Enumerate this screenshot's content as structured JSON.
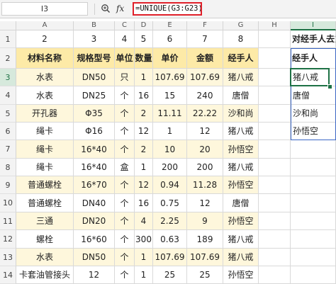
{
  "formula_bar": {
    "name_box": "I3",
    "fx_label": "fx",
    "formula": "=UNIQUE(G3:G23)"
  },
  "columns": [
    "A",
    "B",
    "C",
    "D",
    "E",
    "F",
    "G",
    "H",
    "I"
  ],
  "rows": [
    {
      "num": "1",
      "cells": [
        "2",
        "3",
        "4",
        "5",
        "6",
        "7",
        "8",
        "",
        ""
      ]
    },
    {
      "num": "2",
      "cells": [
        "材料名称",
        "规格型号",
        "单位",
        "数量",
        "单价",
        "金额",
        "经手人",
        "",
        "经手人"
      ]
    },
    {
      "num": "3",
      "cells": [
        "水表",
        "DN50",
        "只",
        "1",
        "107.69",
        "107.69",
        "猪八戒",
        "",
        "猪八戒"
      ]
    },
    {
      "num": "4",
      "cells": [
        "水表",
        "DN25",
        "个",
        "16",
        "15",
        "240",
        "唐僧",
        "",
        "唐僧"
      ]
    },
    {
      "num": "5",
      "cells": [
        "开孔器",
        "Φ35",
        "个",
        "2",
        "11.11",
        "22.22",
        "沙和尚",
        "",
        "沙和尚"
      ]
    },
    {
      "num": "6",
      "cells": [
        "绳卡",
        "Φ16",
        "个",
        "12",
        "1",
        "12",
        "猪八戒",
        "",
        "孙悟空"
      ]
    },
    {
      "num": "7",
      "cells": [
        "绳卡",
        "16*40",
        "个",
        "2",
        "10",
        "20",
        "孙悟空",
        "",
        ""
      ]
    },
    {
      "num": "8",
      "cells": [
        "绳卡",
        "16*40",
        "盒",
        "1",
        "200",
        "200",
        "猪八戒",
        "",
        ""
      ]
    },
    {
      "num": "9",
      "cells": [
        "普通螺栓",
        "16*70",
        "个",
        "12",
        "0.94",
        "11.28",
        "孙悟空",
        "",
        ""
      ]
    },
    {
      "num": "10",
      "cells": [
        "普通螺栓",
        "DN40",
        "个",
        "16",
        "0.75",
        "12",
        "唐僧",
        "",
        ""
      ]
    },
    {
      "num": "11",
      "cells": [
        "三通",
        "DN20",
        "个",
        "4",
        "2.25",
        "9",
        "孙悟空",
        "",
        ""
      ]
    },
    {
      "num": "12",
      "cells": [
        "螺栓",
        "16*60",
        "个",
        "300",
        "0.63",
        "189",
        "猪八戒",
        "",
        ""
      ]
    },
    {
      "num": "13",
      "cells": [
        "水表",
        "DN50",
        "个",
        "1",
        "107.69",
        "107.69",
        "猪八戒",
        "",
        ""
      ]
    },
    {
      "num": "14",
      "cells": [
        "卡套油管接头",
        "12",
        "个",
        "1",
        "25",
        "25",
        "孙悟空",
        "",
        ""
      ]
    }
  ],
  "i1_label": "对经手人去重",
  "colors": {
    "header_fill": "#fdeaa7",
    "band_fill": "#fef7dc",
    "selection": "#1e7145",
    "formula_border": "#e0202a",
    "spill_border": "#3a66c4"
  },
  "icons": [
    "zoom-icon"
  ]
}
